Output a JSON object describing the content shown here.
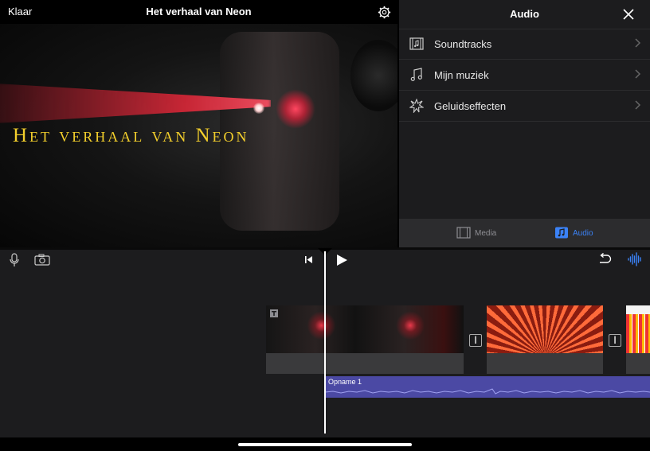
{
  "topbar": {
    "done_label": "Klaar",
    "title": "Het verhaal van Neon",
    "settings_icon": "gear-icon"
  },
  "viewer": {
    "overlay_title": "Het verhaal van Neon"
  },
  "audio_panel": {
    "title": "Audio",
    "close_icon": "close-icon",
    "items": [
      {
        "label": "Soundtracks",
        "icon": "film-music-icon"
      },
      {
        "label": "Mijn muziek",
        "icon": "music-note-icon"
      },
      {
        "label": "Geluidseffecten",
        "icon": "burst-icon"
      }
    ],
    "tabs": [
      {
        "label": "Media",
        "icon": "film-icon",
        "selected": false
      },
      {
        "label": "Audio",
        "icon": "music-icon",
        "selected": true
      }
    ]
  },
  "timeline": {
    "audio_clip_label": "Opname 1",
    "transition_glyph": "|",
    "accent_color": "#3b82f6",
    "audio_color": "#4b49a4"
  }
}
